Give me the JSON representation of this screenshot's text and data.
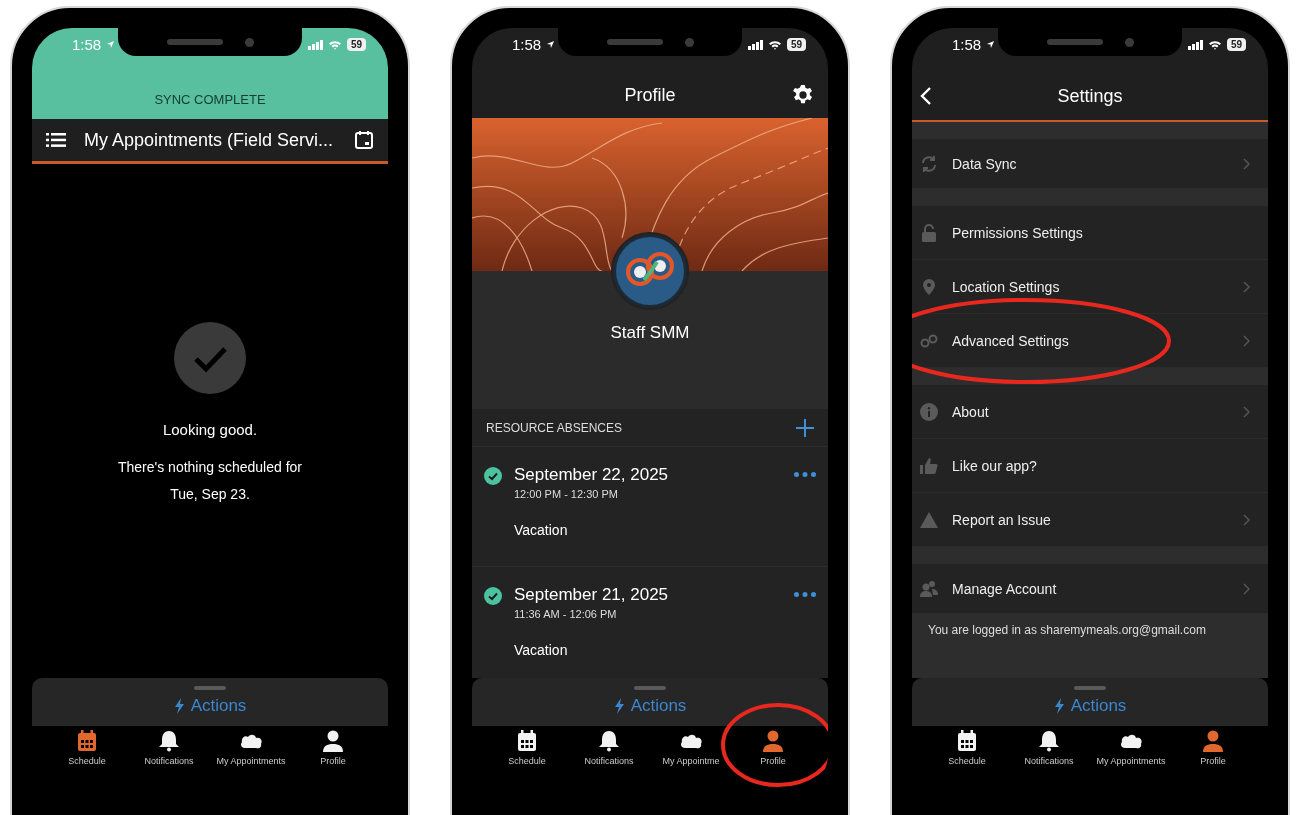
{
  "phones": [
    {
      "kind": "schedule",
      "status_bar": {
        "time": "1:58",
        "battery": "59"
      },
      "banner": "SYNC COMPLETE",
      "header": {
        "title": "My Appointments (Field Servi..."
      },
      "empty_state": {
        "title": "Looking good.",
        "lines": [
          "There's nothing scheduled for",
          "Tue, Sep 23."
        ]
      },
      "actions": "Actions",
      "tabs": [
        {
          "label": "Schedule",
          "selected": true,
          "circled": false
        },
        {
          "label": "Notifications",
          "selected": false,
          "circled": false
        },
        {
          "label": "My Appointments",
          "selected": false,
          "circled": false
        },
        {
          "label": "Profile",
          "selected": false,
          "circled": false
        }
      ]
    },
    {
      "kind": "profile",
      "status_bar": {
        "time": "1:58",
        "battery": "59"
      },
      "header": {
        "title": "Profile"
      },
      "profile": {
        "name": "Staff SMM"
      },
      "absences": {
        "heading": "RESOURCE ABSENCES",
        "items": [
          {
            "date": "September 22, 2025",
            "time": "12:00 PM - 12:30 PM",
            "type": "Vacation",
            "approved": true
          },
          {
            "date": "September 21, 2025",
            "time": "11:36 AM - 12:06 PM",
            "type": "Vacation",
            "approved": true
          }
        ]
      },
      "actions": "Actions",
      "tabs": [
        {
          "label": "Schedule",
          "selected": false,
          "circled": false
        },
        {
          "label": "Notifications",
          "selected": false,
          "circled": false
        },
        {
          "label": "My Appointme",
          "selected": false,
          "circled": false
        },
        {
          "label": "Profile",
          "selected": true,
          "circled": true
        }
      ]
    },
    {
      "kind": "settings",
      "status_bar": {
        "time": "1:58",
        "battery": "59"
      },
      "header": {
        "title": "Settings"
      },
      "groups": [
        [
          {
            "label": "Data Sync",
            "chevron": true,
            "circled": false
          }
        ],
        [
          {
            "label": "Permissions Settings",
            "chevron": false,
            "circled": false
          },
          {
            "label": "Location Settings",
            "chevron": true,
            "circled": false
          },
          {
            "label": "Advanced Settings",
            "chevron": true,
            "circled": true
          }
        ],
        [
          {
            "label": "About",
            "chevron": true,
            "circled": false
          },
          {
            "label": "Like our app?",
            "chevron": false,
            "circled": false
          },
          {
            "label": "Report an Issue",
            "chevron": true,
            "circled": false
          }
        ],
        [
          {
            "label": "Manage Account",
            "chevron": true,
            "circled": false
          }
        ]
      ],
      "account_note": "You are logged in as sharemymeals.org@gmail.com",
      "actions": "Actions",
      "tabs": [
        {
          "label": "Schedule",
          "selected": false,
          "circled": false
        },
        {
          "label": "Notifications",
          "selected": false,
          "circled": false
        },
        {
          "label": "My Appointments",
          "selected": false,
          "circled": false
        },
        {
          "label": "Profile",
          "selected": true,
          "circled": false
        }
      ]
    }
  ]
}
